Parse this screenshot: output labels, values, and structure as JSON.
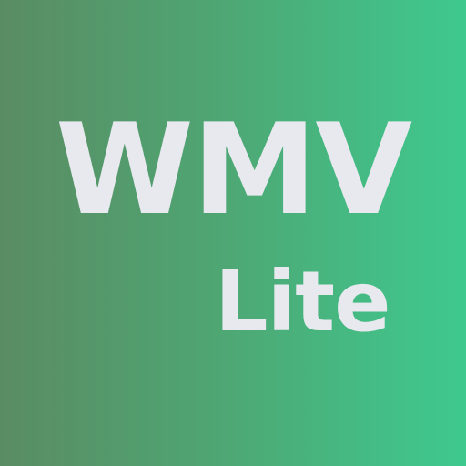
{
  "icon": {
    "title": "WMV",
    "subtitle": "Lite",
    "text_color": "#e7e9ef",
    "background_gradient": [
      "#5a8c63",
      "#3ec98f"
    ]
  }
}
